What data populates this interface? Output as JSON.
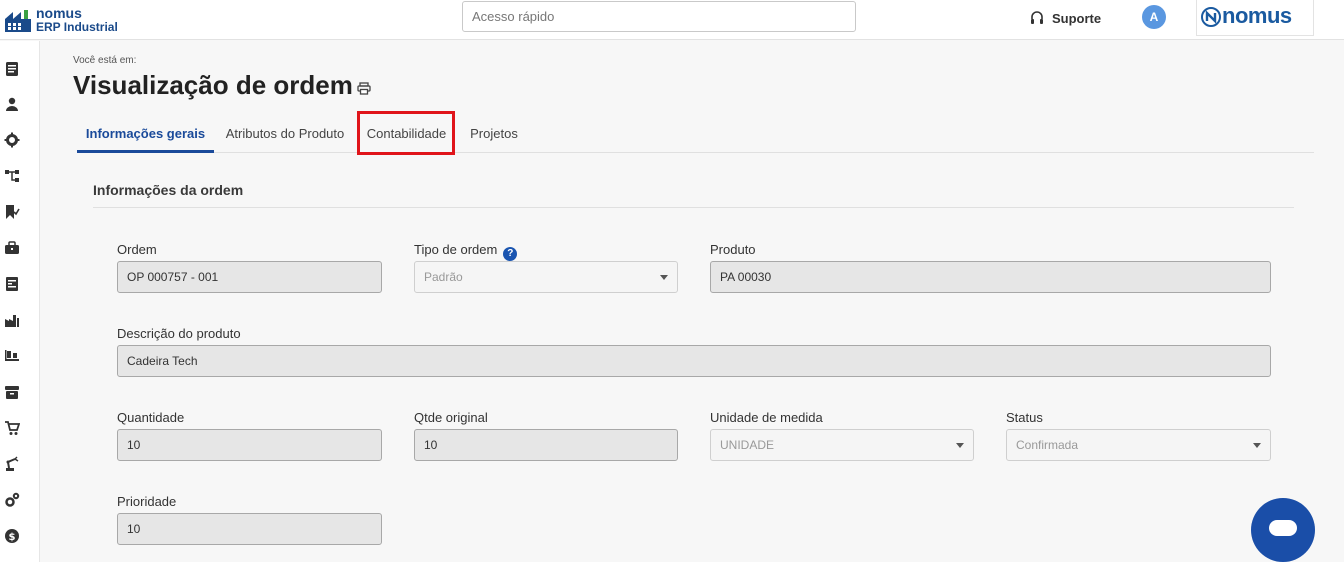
{
  "app": {
    "logo_name": "nomus",
    "logo_subtitle": "ERP Industrial",
    "brand_text": "nomus"
  },
  "topbar": {
    "search_placeholder": "Acesso rápido",
    "support_label": "Suporte",
    "avatar_initial": "A"
  },
  "sidebar": {
    "items": [
      {
        "icon": "document-icon"
      },
      {
        "icon": "user-icon"
      },
      {
        "icon": "gear-icon"
      },
      {
        "icon": "hierarchy-icon"
      },
      {
        "icon": "bookmark-check-icon"
      },
      {
        "icon": "briefcase-icon"
      },
      {
        "icon": "report-icon"
      },
      {
        "icon": "factory-icon"
      },
      {
        "icon": "pallet-icon"
      },
      {
        "icon": "archive-box-icon"
      },
      {
        "icon": "cart-icon"
      },
      {
        "icon": "robot-arm-icon"
      },
      {
        "icon": "settings-gears-icon"
      },
      {
        "icon": "dollar-icon"
      }
    ]
  },
  "page": {
    "breadcrumb": "Você está em:",
    "title": "Visualização de ordem"
  },
  "tabs": [
    {
      "label": "Informações gerais",
      "active": true
    },
    {
      "label": "Atributos do Produto",
      "active": false
    },
    {
      "label": "Contabilidade",
      "active": false,
      "highlighted": true
    },
    {
      "label": "Projetos",
      "active": false
    }
  ],
  "section": {
    "title": "Informações da ordem"
  },
  "fields": {
    "ordem": {
      "label": "Ordem",
      "value": "OP 000757 - 001"
    },
    "tipo_ordem": {
      "label": "Tipo de ordem",
      "value": "Padrão"
    },
    "produto": {
      "label": "Produto",
      "value": "PA 00030"
    },
    "descricao": {
      "label": "Descrição do produto",
      "value": "Cadeira Tech"
    },
    "quantidade": {
      "label": "Quantidade",
      "value": "10"
    },
    "qtde_original": {
      "label": "Qtde original",
      "value": "10"
    },
    "unidade": {
      "label": "Unidade de medida",
      "value": "UNIDADE"
    },
    "status": {
      "label": "Status",
      "value": "Confirmada"
    },
    "prioridade": {
      "label": "Prioridade",
      "value": "10"
    }
  },
  "colors": {
    "accent": "#1a4a9a",
    "highlight": "#e0141a",
    "chat": "#1a4ea8"
  }
}
